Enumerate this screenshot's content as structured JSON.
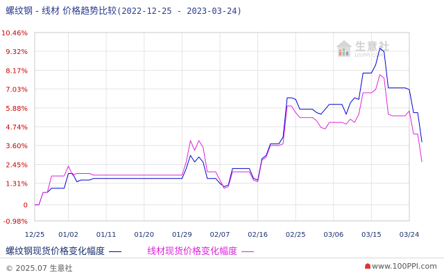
{
  "header": {
    "title": "螺纹钢 - 线材 价格趋势比较",
    "date_range": "(2022-12-25 - 2023-03-24)"
  },
  "watermark": {
    "name": "生意社",
    "url": "100PPI.COM"
  },
  "footer": {
    "copyright": "© 2025.07 生意社",
    "site": "www.100PPI.com"
  },
  "colors": {
    "series1": "#0000cc",
    "series2": "#dd22dd",
    "tick_text": "#cc0000",
    "date_text": "#1a2f6e"
  },
  "chart_data": {
    "type": "line",
    "title": "螺纹钢 - 线材 价格趋势比较",
    "xlabel": "",
    "ylabel": "",
    "ylim": [
      -0.98,
      10.46
    ],
    "y_ticks": [
      "10.46%",
      "9.32%",
      "8.17%",
      "7.03%",
      "5.88%",
      "4.74%",
      "3.60%",
      "2.45%",
      "1.31%",
      "0",
      "-0.98%"
    ],
    "x_ticks": [
      "12/25",
      "01/02",
      "01/11",
      "01/20",
      "01/29",
      "02/07",
      "02/16",
      "02/25",
      "03/06",
      "03/15",
      "03/24"
    ],
    "x": [
      "12/25",
      "12/26",
      "12/27",
      "12/28",
      "12/29",
      "12/30",
      "12/31",
      "01/01",
      "01/02",
      "01/03",
      "01/04",
      "01/05",
      "01/06",
      "01/07",
      "01/08",
      "01/09",
      "01/10",
      "01/11",
      "01/12",
      "01/13",
      "01/14",
      "01/15",
      "01/16",
      "01/17",
      "01/18",
      "01/19",
      "01/20",
      "01/21",
      "01/22",
      "01/23",
      "01/24",
      "01/25",
      "01/26",
      "01/27",
      "01/28",
      "01/29",
      "01/30",
      "01/31",
      "02/01",
      "02/02",
      "02/03",
      "02/04",
      "02/05",
      "02/06",
      "02/07",
      "02/08",
      "02/09",
      "02/10",
      "02/11",
      "02/12",
      "02/13",
      "02/14",
      "02/15",
      "02/16",
      "02/17",
      "02/18",
      "02/19",
      "02/20",
      "02/21",
      "02/22",
      "02/23",
      "02/24",
      "02/25",
      "02/26",
      "02/27",
      "02/28",
      "03/01",
      "03/02",
      "03/03",
      "03/04",
      "03/05",
      "03/06",
      "03/07",
      "03/08",
      "03/09",
      "03/10",
      "03/11",
      "03/12",
      "03/13",
      "03/14",
      "03/15",
      "03/16",
      "03/17",
      "03/18",
      "03/19",
      "03/20",
      "03/21",
      "03/22",
      "03/23",
      "03/24"
    ],
    "series": [
      {
        "name": "螺纹钢现货价格变化幅度",
        "values": [
          0,
          0,
          0.75,
          0.75,
          1.0,
          1.0,
          1.0,
          1.0,
          1.9,
          1.9,
          1.4,
          1.5,
          1.5,
          1.5,
          1.6,
          1.6,
          1.6,
          1.6,
          1.6,
          1.6,
          1.6,
          1.6,
          1.6,
          1.6,
          1.6,
          1.6,
          1.6,
          1.6,
          1.6,
          1.6,
          1.6,
          1.6,
          1.6,
          1.6,
          1.6,
          1.6,
          2.2,
          3.0,
          2.6,
          2.9,
          2.6,
          1.6,
          1.6,
          1.6,
          1.3,
          1.1,
          1.2,
          2.2,
          2.2,
          2.2,
          2.2,
          2.2,
          1.6,
          1.5,
          2.8,
          3.0,
          3.7,
          3.7,
          3.7,
          4.1,
          6.5,
          6.5,
          6.4,
          5.8,
          5.8,
          5.8,
          5.8,
          5.6,
          5.5,
          5.8,
          6.1,
          6.1,
          6.1,
          6.1,
          5.5,
          6.2,
          6.5,
          6.4,
          8.0,
          8.0,
          8.0,
          8.5,
          9.5,
          9.3,
          7.1,
          7.1,
          7.1,
          7.1,
          7.1,
          7.0,
          5.6,
          5.6,
          3.8
        ]
      },
      {
        "name": "线材现货价格变化幅度",
        "values": [
          0,
          0,
          0.75,
          0.75,
          1.75,
          1.75,
          1.75,
          1.75,
          2.35,
          1.8,
          1.9,
          1.9,
          1.9,
          1.9,
          1.8,
          1.8,
          1.8,
          1.8,
          1.8,
          1.8,
          1.8,
          1.8,
          1.8,
          1.8,
          1.8,
          1.8,
          1.8,
          1.8,
          1.8,
          1.8,
          1.8,
          1.8,
          1.8,
          1.8,
          1.8,
          1.8,
          2.6,
          3.9,
          3.3,
          3.9,
          3.5,
          2.0,
          2.0,
          2.0,
          1.5,
          1.0,
          1.1,
          2.0,
          2.0,
          2.0,
          2.0,
          2.0,
          1.5,
          1.4,
          2.7,
          2.9,
          3.6,
          3.6,
          3.6,
          3.7,
          6.0,
          6.0,
          5.6,
          5.3,
          5.3,
          5.3,
          5.3,
          5.1,
          4.7,
          4.6,
          5.0,
          5.0,
          5.0,
          5.0,
          4.9,
          5.2,
          5.0,
          5.5,
          6.8,
          6.8,
          6.8,
          7.0,
          7.9,
          7.7,
          5.5,
          5.4,
          5.4,
          5.4,
          5.4,
          5.7,
          4.3,
          4.3,
          2.6
        ]
      }
    ],
    "grid": true,
    "legend_position": "bottom"
  }
}
